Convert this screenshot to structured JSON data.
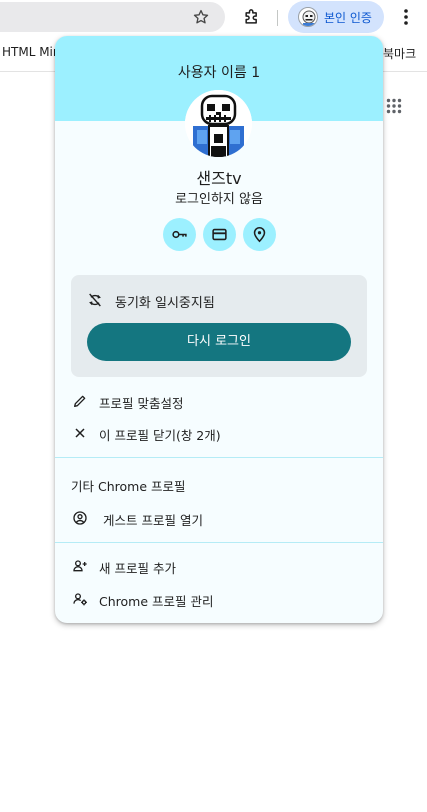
{
  "toolbar": {
    "profile_chip_label": "본인 인증",
    "bookmark_left": "HTML Mir",
    "bookmark_right": "북마크"
  },
  "popup": {
    "title": "사용자 이름 1",
    "name": "샌즈tv",
    "status": "로그인하지 않음",
    "quick_buttons": [
      {
        "name": "password-manager",
        "icon": "key-icon"
      },
      {
        "name": "payment-methods",
        "icon": "credit-card-icon"
      },
      {
        "name": "addresses",
        "icon": "location-pin-icon"
      }
    ],
    "sync_text": "동기화 일시중지됨",
    "signin_label": "다시 로그인",
    "menu": {
      "customize": "프로필 맞춤설정",
      "close_profile": "이 프로필 닫기(창 2개)"
    },
    "other_profiles_header": "기타 Chrome 프로필",
    "guest": "게스트 프로필 열기",
    "add_profile": "새 프로필 추가",
    "manage_profiles": "Chrome 프로필 관리"
  },
  "colors": {
    "banner": "#9cf0ff",
    "accent_button": "#147680",
    "chip": "#d3e3fd",
    "chip_text": "#0b57d0"
  }
}
